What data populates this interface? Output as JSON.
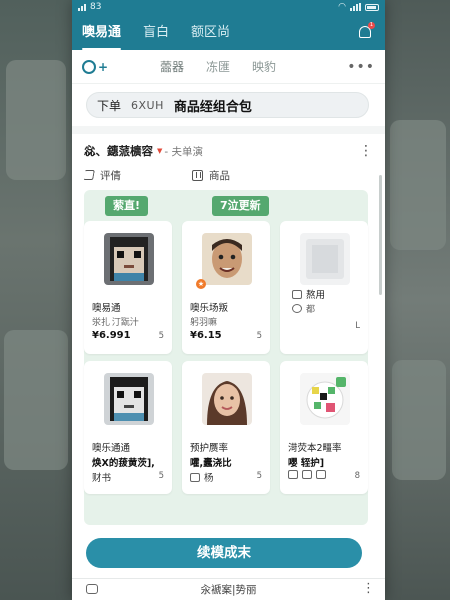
{
  "status": {
    "time": "83"
  },
  "topnav": {
    "tabs": [
      {
        "label": "噢易通",
        "active": true
      },
      {
        "label": "盲白"
      },
      {
        "label": "额区尚"
      }
    ],
    "notification_count": "1"
  },
  "subnav": {
    "tabs": [
      "蘦器",
      "冻匯",
      "映豹"
    ],
    "more": "•••"
  },
  "search": {
    "prefix": "下单",
    "code": "6XUH",
    "query": "商品绖组合包"
  },
  "section": {
    "title": "惢、鏸蒎櫎容",
    "subtitle": "- 夫单演",
    "actions": {
      "share": "评倩",
      "goods": "商品"
    }
  },
  "tags": {
    "left": "萦直!",
    "right": "7泣更新"
  },
  "products": [
    {
      "name": "噢易通",
      "sub": "泶扎 汀翫汁",
      "price": "¥6.991",
      "r": "5"
    },
    {
      "name": "噢乐场叛",
      "sub": "躬羽嘛",
      "price": "¥6.15",
      "r": "5"
    },
    {
      "name": "熬用",
      "sub": "都",
      "price": "",
      "r": "L"
    },
    {
      "name": "噢乐通通",
      "sub": "焕X的菝黄茨], ",
      "price": "财书",
      "r": "5"
    },
    {
      "name": "预护赝率",
      "sub": "嚯,蠹浇比",
      "price": "杨",
      "r": "5"
    },
    {
      "name": "渮荧本2疅率",
      "sub": "嚶 轾护]",
      "price": "",
      "r": "8"
    }
  ],
  "primary_button": "续模成末",
  "footer": {
    "label": "汆褫案|势丽"
  },
  "colors": {
    "brand": "#1f7c93",
    "button": "#2a8fa8",
    "tag": "#55a86f",
    "panel": "#e6f2ea"
  }
}
